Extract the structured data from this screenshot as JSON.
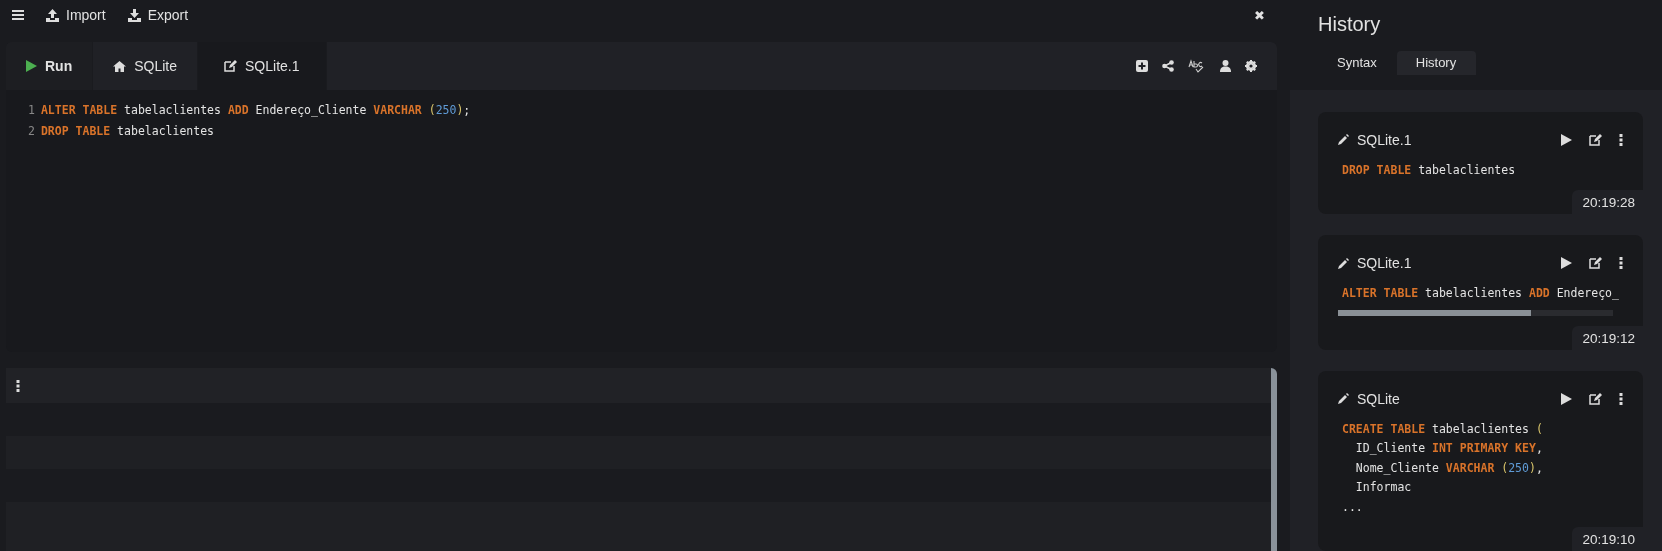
{
  "toolbar": {
    "items": [
      {
        "kind": "menu"
      },
      {
        "kind": "import",
        "label": "Import"
      },
      {
        "kind": "export",
        "label": "Export"
      },
      {
        "kind": "close",
        "label": "✖"
      }
    ]
  },
  "editor": {
    "tabs": [
      {
        "kind": "run",
        "label": "Run",
        "selected": false
      },
      {
        "kind": "home",
        "label": "SQLite",
        "selected": false
      },
      {
        "kind": "edit",
        "label": "SQLite.1",
        "selected": true
      }
    ],
    "tools": [
      {
        "kind": "add"
      },
      {
        "kind": "share"
      },
      {
        "kind": "spell"
      },
      {
        "kind": "user"
      },
      {
        "kind": "settings"
      }
    ],
    "lines": [
      {
        "number": "1",
        "tokens": [
          {
            "kind": "keyword",
            "text": "ALTER TABLE"
          },
          {
            "kind": "plain",
            "text": " tabelaclientes "
          },
          {
            "kind": "keyword",
            "text": "ADD"
          },
          {
            "kind": "plain",
            "text": " Endereço_Cliente "
          },
          {
            "kind": "keyword",
            "text": "VARCHAR"
          },
          {
            "kind": "paren",
            "text": " ("
          },
          {
            "kind": "number",
            "text": "250"
          },
          {
            "kind": "paren",
            "text": ")"
          },
          {
            "kind": "plain",
            "text": ";"
          }
        ]
      },
      {
        "number": "2",
        "tokens": [
          {
            "kind": "keyword",
            "text": "DROP TABLE"
          },
          {
            "kind": "plain",
            "text": " tabelaclientes"
          }
        ]
      }
    ]
  },
  "history_panel": {
    "title": "History",
    "tabs": [
      {
        "label": "Syntax",
        "selected": false
      },
      {
        "label": "History",
        "selected": true
      }
    ],
    "entries": [
      {
        "title": "SQLite.1",
        "time": "20:19:28",
        "scrollbar": false,
        "lines": [
          [
            {
              "kind": "keyword",
              "text": "DROP TABLE"
            },
            {
              "kind": "plain",
              "text": " tabelaclientes"
            }
          ]
        ]
      },
      {
        "title": "SQLite.1",
        "time": "20:19:12",
        "scrollbar": true,
        "lines": [
          [
            {
              "kind": "keyword",
              "text": "ALTER TABLE"
            },
            {
              "kind": "plain",
              "text": " tabelaclientes "
            },
            {
              "kind": "keyword",
              "text": "ADD"
            },
            {
              "kind": "plain",
              "text": " Endereço_"
            }
          ]
        ]
      },
      {
        "title": "SQLite",
        "time": "20:19:10",
        "scrollbar": false,
        "lines": [
          [
            {
              "kind": "keyword",
              "text": "CREATE TABLE"
            },
            {
              "kind": "plain",
              "text": " tabelaclientes "
            },
            {
              "kind": "paren",
              "text": "("
            }
          ],
          [
            {
              "kind": "plain",
              "text": "  ID_Cliente "
            },
            {
              "kind": "keyword",
              "text": "INT PRIMARY KEY"
            },
            {
              "kind": "plain",
              "text": ","
            }
          ],
          [
            {
              "kind": "plain",
              "text": "  Nome_Cliente "
            },
            {
              "kind": "keyword",
              "text": "VARCHAR"
            },
            {
              "kind": "paren",
              "text": " ("
            },
            {
              "kind": "number",
              "text": "250"
            },
            {
              "kind": "paren",
              "text": ")"
            },
            {
              "kind": "plain",
              "text": ","
            }
          ],
          [
            {
              "kind": "plain",
              "text": "  Informac"
            }
          ],
          [
            {
              "kind": "plain",
              "text": "..."
            }
          ]
        ]
      }
    ]
  }
}
